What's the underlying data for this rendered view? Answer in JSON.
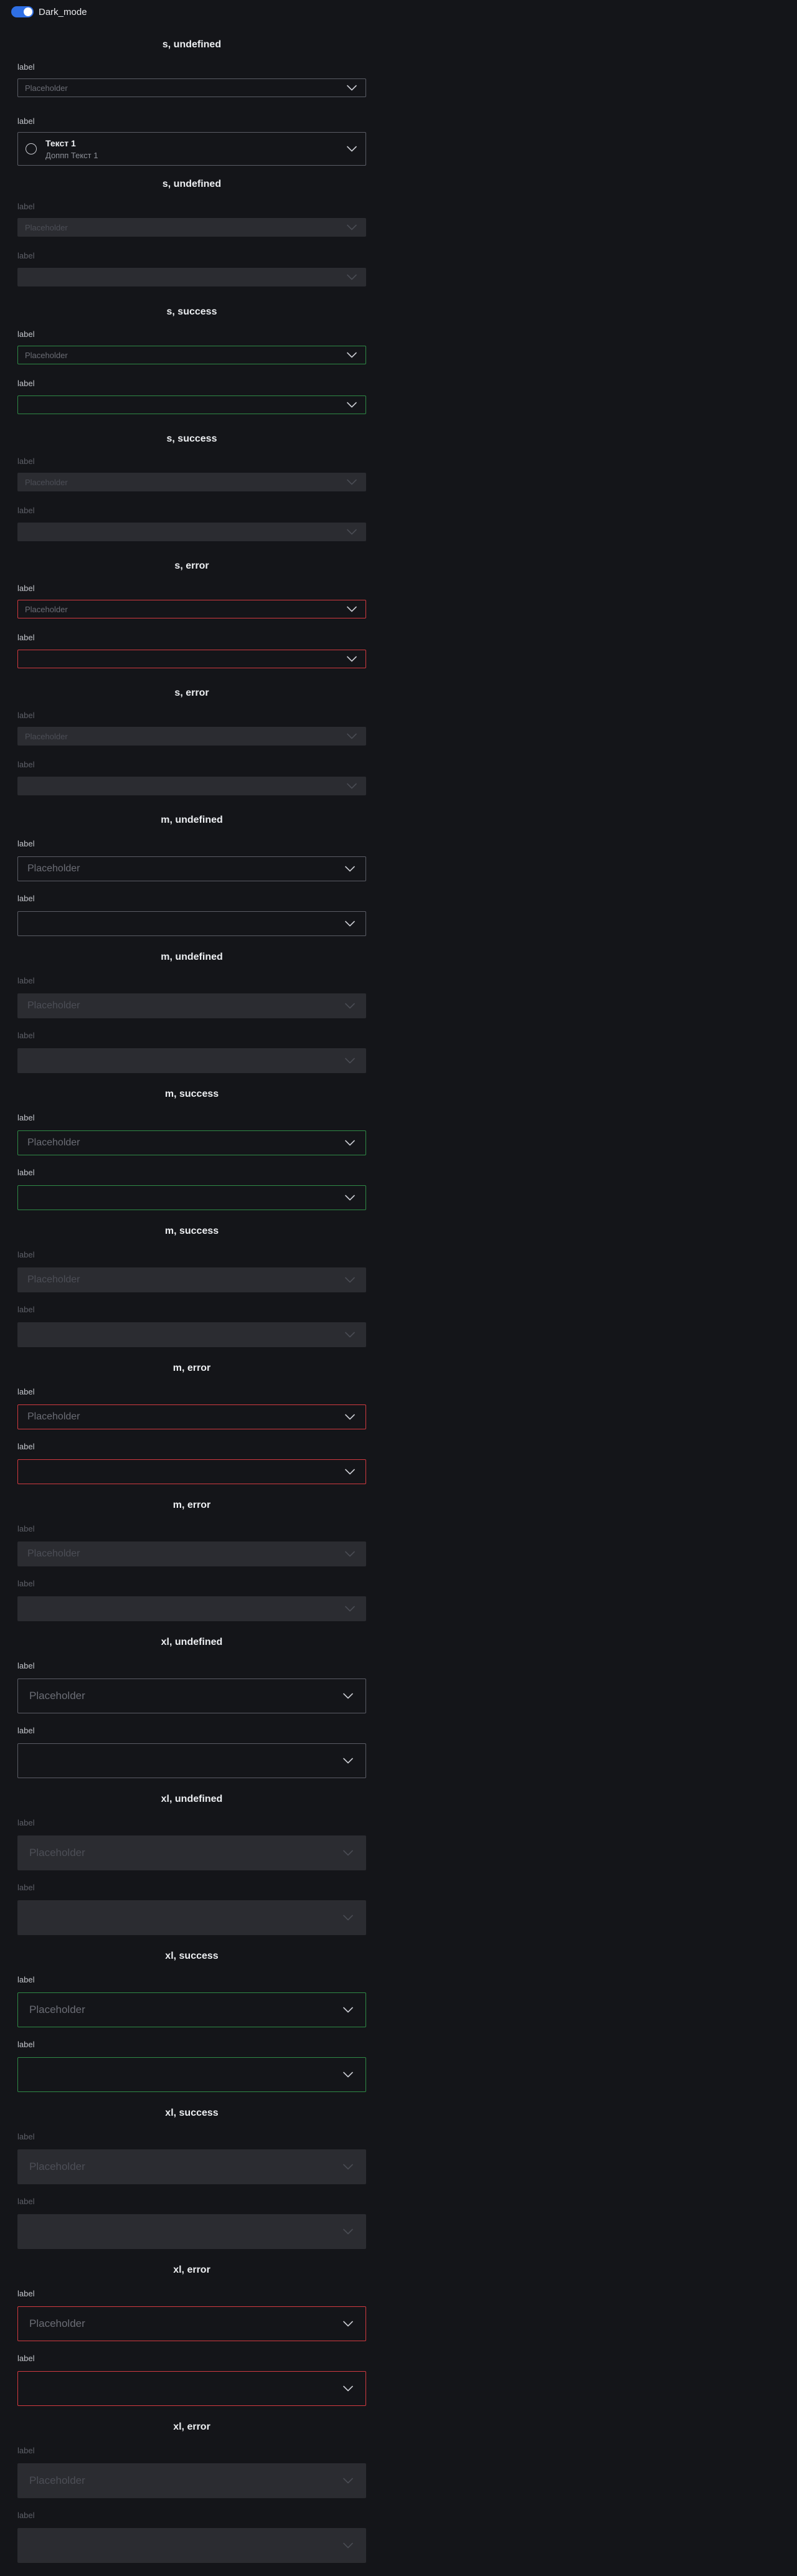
{
  "header": {
    "toggle_label": "Dark_mode",
    "toggle_on": true
  },
  "common": {
    "label": "label",
    "placeholder": "Placeholder"
  },
  "rich_option": {
    "title": "Текст 1",
    "subtitle": "Доппп Текст 1"
  },
  "colors": {
    "background": "#141519",
    "accent": "#2f6fe4",
    "border_default": "#5b5d66",
    "border_success": "#2f8a46",
    "border_error": "#d23a40",
    "disabled_fill": "#2b2c31"
  },
  "sections": [
    {
      "title": "s, undefined",
      "size": "s",
      "status": "undefined",
      "disabled": false
    },
    {
      "title": "s, undefined",
      "size": "s",
      "status": "undefined",
      "disabled": true
    },
    {
      "title": "s, success",
      "size": "s",
      "status": "success",
      "disabled": false
    },
    {
      "title": "s, success",
      "size": "s",
      "status": "success",
      "disabled": true
    },
    {
      "title": "s, error",
      "size": "s",
      "status": "error",
      "disabled": false
    },
    {
      "title": "s, error",
      "size": "s",
      "status": "error",
      "disabled": true
    },
    {
      "title": "m, undefined",
      "size": "m",
      "status": "undefined",
      "disabled": false
    },
    {
      "title": "m, undefined",
      "size": "m",
      "status": "undefined",
      "disabled": true
    },
    {
      "title": "m, success",
      "size": "m",
      "status": "success",
      "disabled": false
    },
    {
      "title": "m, success",
      "size": "m",
      "status": "success",
      "disabled": true
    },
    {
      "title": "m, error",
      "size": "m",
      "status": "error",
      "disabled": false
    },
    {
      "title": "m, error",
      "size": "m",
      "status": "error",
      "disabled": true
    },
    {
      "title": "xl, undefined",
      "size": "xl",
      "status": "undefined",
      "disabled": false
    },
    {
      "title": "xl, undefined",
      "size": "xl",
      "status": "undefined",
      "disabled": true
    },
    {
      "title": "xl, success",
      "size": "xl",
      "status": "success",
      "disabled": false
    },
    {
      "title": "xl, success",
      "size": "xl",
      "status": "success",
      "disabled": true
    },
    {
      "title": "xl, error",
      "size": "xl",
      "status": "error",
      "disabled": false
    },
    {
      "title": "xl, error",
      "size": "xl",
      "status": "error",
      "disabled": true
    }
  ]
}
